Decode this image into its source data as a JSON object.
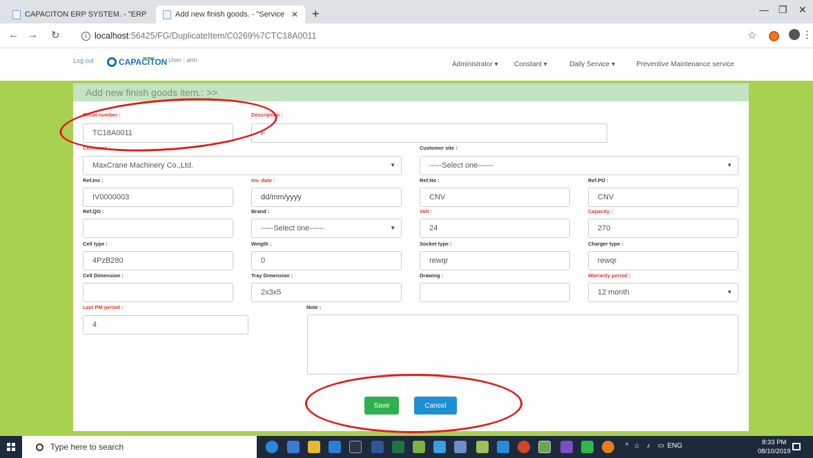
{
  "browser": {
    "tabs": [
      {
        "title": "CAPACITON ERP SYSTEM. - \"ERP"
      },
      {
        "title": "Add new finish goods. - \"Service"
      }
    ],
    "url_host": "localhost",
    "url_path": ":56425/FG/DuplicateItem/C0269%7CTC18A0011"
  },
  "header": {
    "logout": "Log out",
    "logo_text": "CAPACITON",
    "user": "User : ann",
    "menu": [
      "Administrator ▾",
      "Constant ▾",
      "Daily Service ▾",
      "Preventive Maintenance service"
    ]
  },
  "form": {
    "title": "Add new finish goods item.: >>",
    "serial_label": "Serial number :",
    "serial_value": "TC18A0011",
    "desc_label": "Description :",
    "desc_value": "F",
    "customer_label": "Customer :",
    "customer_value": "MaxCrane Machinery Co.,Ltd.",
    "site_label": "Customer site :",
    "site_value": "-----Select one------",
    "refinv_label": "Ref.Inv :",
    "refinv_value": "IV0000003",
    "invdate_label": "Inv. date :",
    "invdate_placeholder": "dd/mm/yyyy",
    "refno_label": "Ref.No :",
    "refno_value": "CNV",
    "refpo_label": "Ref.PO :",
    "refpo_value": "CNV",
    "refqo_label": "Ref.QO :",
    "refqo_value": "",
    "brand_label": "Brand :",
    "brand_value": "-----Select one------",
    "volt_label": "Volt :",
    "volt_value": "24",
    "capacity_label": "Capacity :",
    "capacity_value": "270",
    "celltype_label": "Cell type :",
    "celltype_value": "4PzB280",
    "weight_label": "Weigth :",
    "weight_value": "0",
    "socket_label": "Socket type :",
    "socket_value": "rewqr",
    "charger_label": "Charger type :",
    "charger_value": "rewqr",
    "celldim_label": "Cell Dimension :",
    "celldim_value": "",
    "traydim_label": "Tray Dimension :",
    "traydim_value": "2x3x5",
    "drawing_label": "Drawing :",
    "drawing_value": "",
    "warranty_label": "Warranty period :",
    "warranty_value": "12 month",
    "lastpm_label": "Last PM period :",
    "lastpm_value": "4",
    "note_label": "Note :",
    "note_value": "",
    "save": "Save",
    "cancel": "Cancel"
  },
  "taskbar": {
    "search_placeholder": "Type here to search",
    "lang": "ENG",
    "time": "8:33 PM",
    "date": "08/10/2019"
  }
}
